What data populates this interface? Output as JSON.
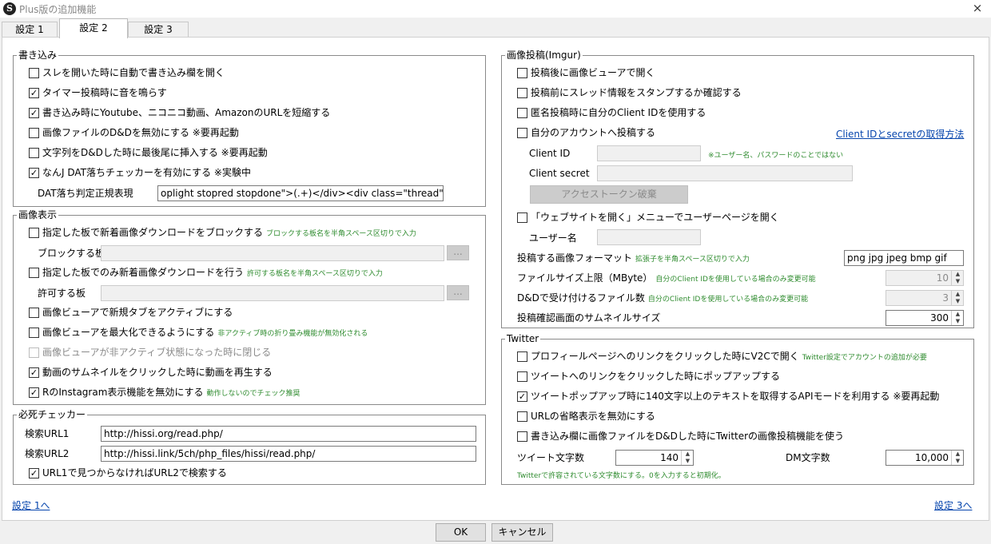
{
  "window": {
    "icon_letter": "S",
    "title": "Plus版の追加機能",
    "close_icon": "×"
  },
  "tabs": [
    {
      "label": "設定 1"
    },
    {
      "label": "設定 2"
    },
    {
      "label": "設定 3"
    }
  ],
  "write": {
    "title": "書き込み",
    "items": [
      {
        "label": "スレを開いた時に自動で書き込み欄を開く",
        "checked": false
      },
      {
        "label": "タイマー投稿時に音を鳴らす",
        "checked": true
      },
      {
        "label": "書き込み時にYoutube、ニコニコ動画、AmazonのURLを短縮する",
        "checked": true
      },
      {
        "label": "画像ファイルのD&Dを無効にする ※要再起動",
        "checked": false
      },
      {
        "label": "文字列をD&Dした時に最後尾に挿入する ※要再起動",
        "checked": false
      },
      {
        "label": "なんJ DAT落ちチェッカーを有効にする ※実験中",
        "checked": true
      }
    ],
    "dat_label": "DAT落ち判定正規表現",
    "dat_value": "oplight stopred stopdone\">(.+)</div><div class=\"thread\">"
  },
  "image_display": {
    "title": "画像表示",
    "block_label": "指定した板で新着画像ダウンロードをブロックする",
    "block_hint": "ブロックする板名を半角スペース区切りで入力",
    "block_board_label": "ブロックする板",
    "allow_label": "指定した板でのみ新着画像ダウンロードを行う",
    "allow_hint": "許可する板名を半角スペース区切りで入力",
    "allow_board_label": "許可する板",
    "browse_label": "...",
    "new_tab_label": "画像ビューアで新規タブをアクティブにする",
    "maximize_label": "画像ビューアを最大化できるようにする",
    "maximize_hint": "非アクティブ時の折り畳み機能が無効化される",
    "close_inactive_label": "画像ビューアが非アクティブ状態になった時に閉じる",
    "play_video_label": "動画のサムネイルをクリックした時に動画を再生する",
    "instagram_label": "RのInstagram表示機能を無効にする",
    "instagram_hint": "動作しないのでチェック推奨"
  },
  "hissi": {
    "title": "必死チェッカー",
    "url1_label": "検索URL1",
    "url1_value": "http://hissi.org/read.php/",
    "url2_label": "検索URL2",
    "url2_value": "http://hissi.link/5ch/php_files/hissi/read.php/",
    "fallback_label": "URL1で見つからなければURL2で検索する"
  },
  "imgur": {
    "title": "画像投稿(Imgur)",
    "open_viewer_label": "投稿後に画像ビューアで開く",
    "confirm_stamp_label": "投稿前にスレッド情報をスタンプするか確認する",
    "anon_client_label": "匿名投稿時に自分のClient IDを使用する",
    "own_account_label": "自分のアカウントへ投稿する",
    "howto_link": "Client IDとsecretの取得方法",
    "client_id_label": "Client ID",
    "client_id_hint": "※ユーザー名、パスワードのことではない",
    "client_secret_label": "Client secret",
    "revoke_button": "アクセストークン破棄",
    "open_site_label": "「ウェブサイトを開く」メニューでユーザーページを開く",
    "username_label": "ユーザー名",
    "format_label": "投稿する画像フォーマット",
    "format_hint": "拡張子を半角スペース区切りで入力",
    "format_value": "png jpg jpeg bmp gif",
    "max_size_label": "ファイルサイズ上限（MByte）",
    "max_size_hint": "自分のClient IDを使用している場合のみ変更可能",
    "max_size_value": "10",
    "dnd_files_label": "D&Dで受け付けるファイル数",
    "dnd_files_hint": "自分のClient IDを使用している場合のみ変更可能",
    "dnd_files_value": "3",
    "thumb_size_label": "投稿確認画面のサムネイルサイズ",
    "thumb_size_value": "300"
  },
  "twitter": {
    "title": "Twitter",
    "profile_link_label": "プロフィールページへのリンクをクリックした時にV2Cで開く",
    "profile_link_hint": "Twitter設定でアカウントの追加が必要",
    "tweet_popup_label": "ツイートへのリンクをクリックした時にポップアップする",
    "api_mode_label": "ツイートポップアップ時に140文字以上のテキストを取得するAPIモードを利用する ※要再起動",
    "url_omit_label": "URLの省略表示を無効にする",
    "image_post_label": "書き込み欄に画像ファイルをD&Dした時にTwitterの画像投稿機能を使う",
    "tweet_chars_label": "ツイート文字数",
    "tweet_chars_value": "140",
    "dm_chars_label": "DM文字数",
    "dm_chars_value": "10,000",
    "chars_hint": "Twitterで許容されている文字数にする。0を入力すると初期化。"
  },
  "nav": {
    "prev_link": "設定 1へ",
    "next_link": "設定 3へ"
  },
  "footer": {
    "ok_label": "OK",
    "cancel_label": "キャンセル"
  }
}
